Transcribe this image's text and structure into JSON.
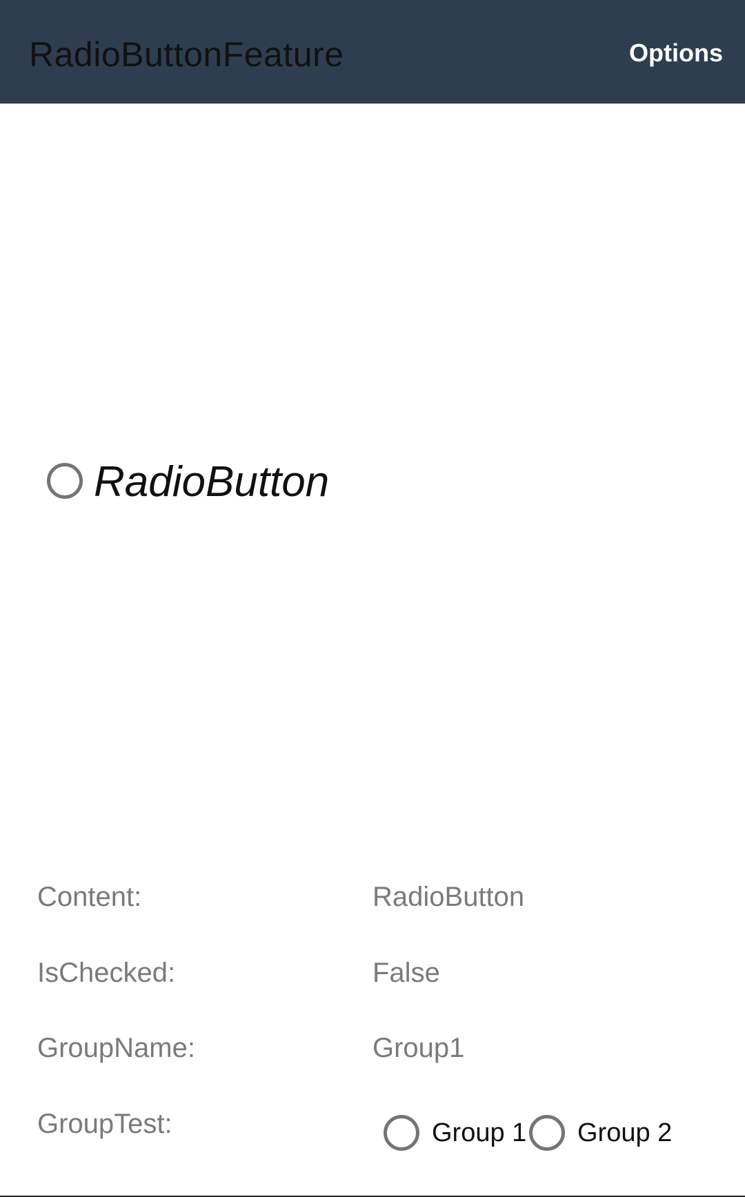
{
  "appbar": {
    "title": "RadioButtonFeature",
    "options_label": "Options",
    "background_color": "#2e3e50"
  },
  "main_radio": {
    "label": "RadioButton",
    "checked": false
  },
  "properties": [
    {
      "label": "Content:",
      "value": "RadioButton"
    },
    {
      "label": "IsChecked:",
      "value": "False"
    },
    {
      "label": "GroupName:",
      "value": "Group1"
    },
    {
      "label": "GroupTest:",
      "value": ""
    }
  ],
  "group_test": {
    "options": [
      {
        "label": "Group 1",
        "checked": false
      },
      {
        "label": "Group 2",
        "checked": false
      }
    ]
  }
}
